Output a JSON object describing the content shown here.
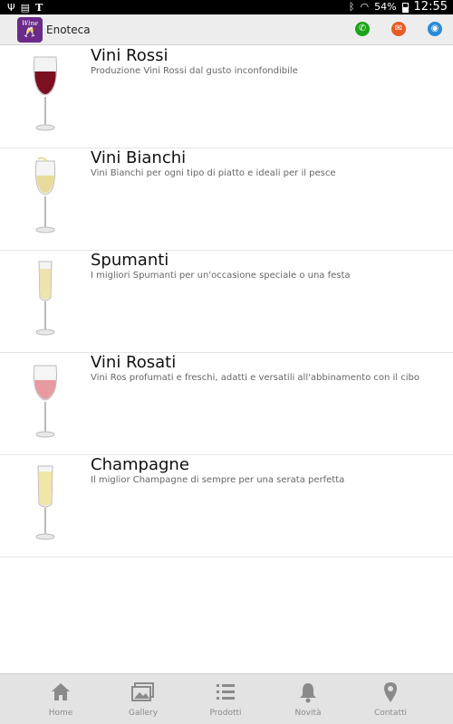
{
  "status_bar": {
    "battery": "54%",
    "time": "12:55",
    "icons": [
      "usb-icon",
      "notification-icon",
      "nyt-icon",
      "bluetooth-icon",
      "wifi-icon",
      "battery-icon"
    ]
  },
  "action_bar": {
    "title": "Enoteca",
    "logo_text": "Wine",
    "colors": {
      "phone": "#1aa31a",
      "mail": "#e85b24",
      "web": "#2a8ad8"
    }
  },
  "products": [
    {
      "title": "Vini Rossi",
      "description": "Produzione Vini Rossi dal gusto inconfondibile",
      "glass": "red-wine-glass"
    },
    {
      "title": "Vini Bianchi",
      "description": "Vini Bianchi per ogni tipo di piatto e ideali per il pesce",
      "glass": "white-wine-glass"
    },
    {
      "title": "Spumanti",
      "description": "I migliori Spumanti per un'occasione speciale o una festa",
      "glass": "flute-glass"
    },
    {
      "title": "Vini Rosati",
      "description": "Vini Ros  profumati e freschi, adatti e versatili all'abbinamento con il cibo",
      "glass": "rose-wine-glass"
    },
    {
      "title": "Champagne",
      "description": "Il miglior Champagne di sempre per una serata perfetta",
      "glass": "champagne-glass"
    }
  ],
  "bottom_nav": {
    "items": [
      {
        "label": "Home",
        "icon": "home-icon"
      },
      {
        "label": "Gallery",
        "icon": "gallery-icon"
      },
      {
        "label": "Prodotti",
        "icon": "list-icon"
      },
      {
        "label": "Novità",
        "icon": "bell-icon"
      },
      {
        "label": "Contatti",
        "icon": "location-pin-icon"
      }
    ]
  }
}
